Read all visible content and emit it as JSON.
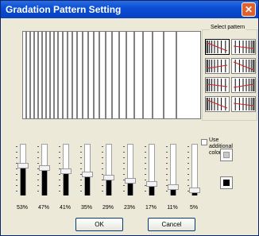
{
  "window": {
    "title": "Gradation Pattern Setting",
    "close_glyph": "✕"
  },
  "select_pattern": {
    "label": "Select pattern",
    "count": 8,
    "selected_index": 0
  },
  "sliders": [
    {
      "label": "53%",
      "level": 0.53
    },
    {
      "label": "47%",
      "level": 0.47
    },
    {
      "label": "41%",
      "level": 0.41
    },
    {
      "label": "35%",
      "level": 0.35
    },
    {
      "label": "29%",
      "level": 0.29
    },
    {
      "label": "23%",
      "level": 0.23
    },
    {
      "label": "17%",
      "level": 0.17
    },
    {
      "label": "11%",
      "level": 0.11
    },
    {
      "label": "5%",
      "level": 0.05
    }
  ],
  "additional_color": {
    "label_line1": "Use additional",
    "label_line2": "color",
    "checked": false
  },
  "buttons": {
    "ok": "OK",
    "cancel": "Cancel"
  },
  "colors": {
    "titlebar": "#0a4fd6",
    "pattern_accent": "#cc2222",
    "face": "#ece9d8"
  }
}
